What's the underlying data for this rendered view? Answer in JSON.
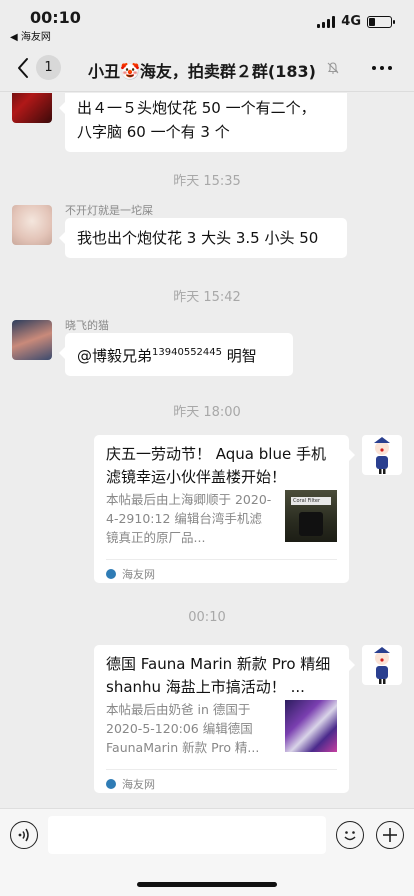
{
  "status": {
    "time": "00:10",
    "back_app": "◀ 海友网",
    "network": "4G",
    "battery_level": 0.3
  },
  "nav": {
    "badge": "1",
    "title": "小丑🤡海友，拍卖群２群(183)"
  },
  "messages": [
    {
      "type": "text",
      "text_lines": [
        "出４一５头炮仗花 50 一个有二个，",
        "八字脑 60 一个有 3 个"
      ]
    },
    {
      "type": "time",
      "text": "昨天 15:35"
    },
    {
      "type": "text",
      "sender": "不开灯就是一坨屎",
      "text": "我也出个炮仗花 3 大头 3.5 小头 50"
    },
    {
      "type": "time",
      "text": "昨天 15:42"
    },
    {
      "type": "text",
      "sender": "晓飞的猫",
      "mention": "@博毅兄弟",
      "mention_num": "13940552445",
      "text_after": " 明智"
    },
    {
      "type": "time",
      "text": "昨天 18:00"
    },
    {
      "type": "card",
      "title": "庆五一劳动节！ Aqua blue 手机滤镜幸运小伙伴盖楼开始！",
      "desc": "本帖最后由上海卿顺于 2020-4-2910:12 编辑台湾手机滤镜真正的原厂品...",
      "thumb_text": "Coral Filter",
      "source": "海友网"
    },
    {
      "type": "time",
      "text": "00:10"
    },
    {
      "type": "card",
      "title": "德国 Fauna Marin 新款 Pro 精细 shanhu 海盐上市搞活动！ ...",
      "desc": "本帖最后由奶爸 in 德国于 2020-5-120:06 编辑德国 FaunaMarin 新款 Pro 精...",
      "source": "海友网"
    }
  ],
  "colors": {
    "background": "#ededed",
    "bubble": "#ffffff",
    "timestamp": "#a8a8a8"
  },
  "icons": [
    "back-chevron-icon",
    "mute-bell-icon",
    "more-dots-icon",
    "voice-icon",
    "emoji-icon",
    "plus-icon"
  ]
}
